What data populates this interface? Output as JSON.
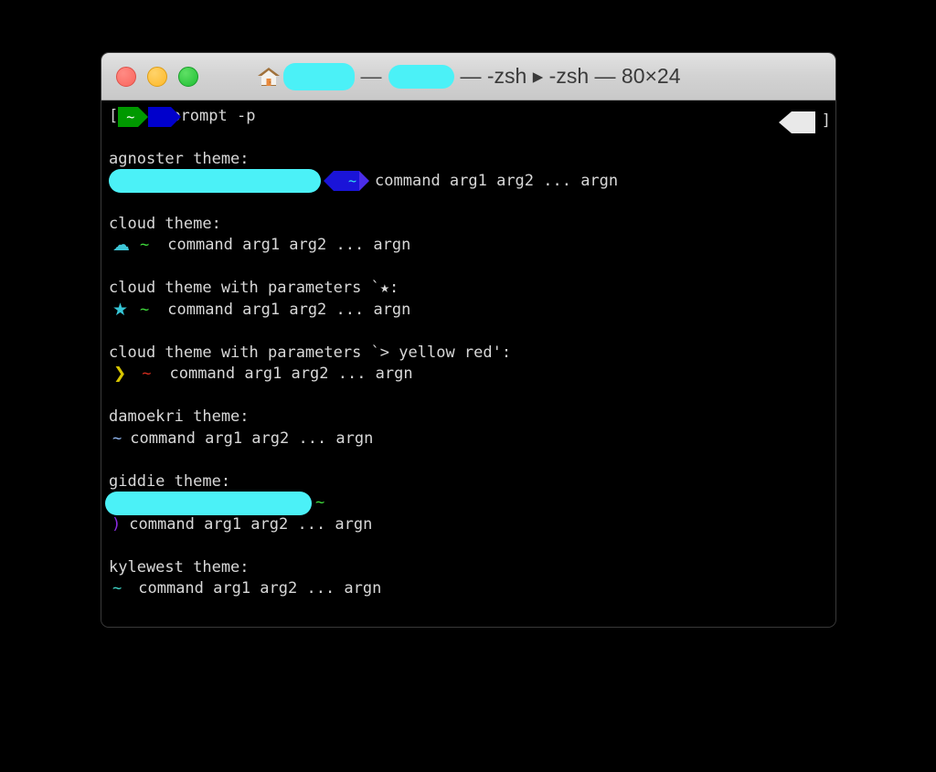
{
  "window": {
    "title_suffix": "— -zsh ▸ -zsh — 80×24",
    "size_label": "80×24",
    "shell": "-zsh",
    "traffic_lights": [
      {
        "name": "close",
        "color": "#f9655c"
      },
      {
        "name": "minimize",
        "color": "#fdb827"
      },
      {
        "name": "maximize",
        "color": "#1fbe33"
      }
    ],
    "home_icon": "home-icon",
    "redacted_title_1": "",
    "redacted_title_2": ""
  },
  "terminal": {
    "prompt": {
      "open_bracket": "[",
      "close_bracket": "]",
      "segment_home": "~",
      "command": "prompt -p"
    },
    "sample_command": "command arg1 arg2 ... argn",
    "themes": [
      {
        "heading": "agnoster theme:",
        "name": "agnoster",
        "segment_home": "~",
        "sample": "command arg1 arg2 ... argn"
      },
      {
        "heading": "cloud theme:",
        "name": "cloud",
        "glyph": "☁",
        "glyph_color": "#3ec6d6",
        "home": "~",
        "home_color": "#3ed63a",
        "sample": "command arg1 arg2 ... argn"
      },
      {
        "heading": "cloud theme with parameters `★:",
        "name": "cloud-star",
        "glyph": "★",
        "glyph_color": "#36c6d6",
        "home": "~",
        "home_color": "#3ed63a",
        "sample": "command arg1 arg2 ... argn"
      },
      {
        "heading": "cloud theme with parameters `> yellow red':",
        "name": "cloud-yellow-red",
        "glyph": "❯",
        "glyph_color": "#d7c500",
        "home": "~",
        "home_color": "#d32c1e",
        "sample": "command arg1 arg2 ... argn"
      },
      {
        "heading": "damoekri theme:",
        "name": "damoekri",
        "home": "~",
        "home_color": "#8fb6f0",
        "sample": "command arg1 arg2 ... argn"
      },
      {
        "heading": "giddie theme:",
        "name": "giddie",
        "home": "~",
        "home_color": "#3ed63a",
        "prompt_char": ")",
        "prompt_char_color": "#8a2be2",
        "sample": "command arg1 arg2 ... argn"
      },
      {
        "heading": "kylewest theme:",
        "name": "kylewest",
        "home": "~",
        "home_color": "#3ed6c8",
        "sample": "command arg1 arg2 ... argn"
      }
    ]
  }
}
